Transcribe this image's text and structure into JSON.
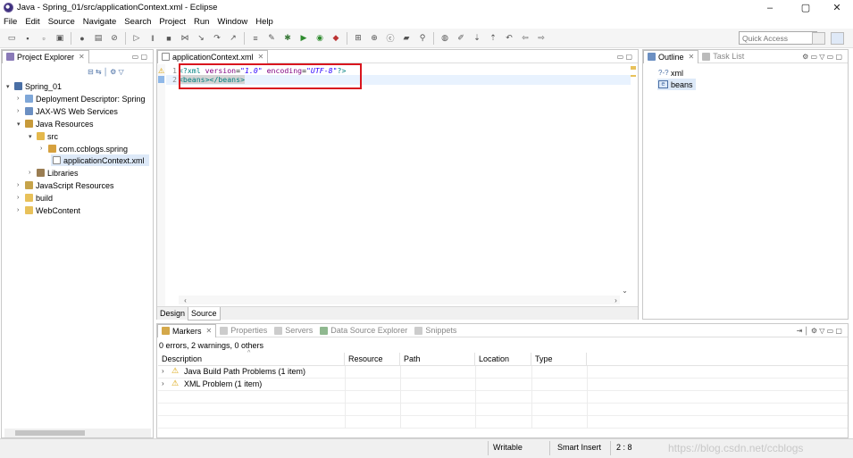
{
  "window": {
    "title": "Java - Spring_01/src/applicationContext.xml - Eclipse",
    "minimize": "–",
    "maximize": "▢",
    "close": "✕"
  },
  "menu": [
    "File",
    "Edit",
    "Source",
    "Navigate",
    "Search",
    "Project",
    "Run",
    "Window",
    "Help"
  ],
  "toolbar": {
    "quick_access_placeholder": "Quick Access"
  },
  "project_explorer": {
    "tab_label": "Project Explorer",
    "tree": [
      {
        "label": "Spring_01",
        "icon": "project-icon"
      },
      {
        "label": "Deployment Descriptor: Spring",
        "icon": "descriptor-icon"
      },
      {
        "label": "JAX-WS Web Services",
        "icon": "webservice-icon"
      },
      {
        "label": "Java Resources",
        "icon": "java-resources-icon"
      },
      {
        "label": "src",
        "icon": "source-folder-icon"
      },
      {
        "label": "com.ccblogs.spring",
        "icon": "package-icon"
      },
      {
        "label": "applicationContext.xml",
        "icon": "xml-file-icon"
      },
      {
        "label": "Libraries",
        "icon": "library-icon"
      },
      {
        "label": "JavaScript Resources",
        "icon": "js-resources-icon"
      },
      {
        "label": "build",
        "icon": "folder-icon"
      },
      {
        "label": "WebContent",
        "icon": "folder-icon"
      }
    ]
  },
  "editor": {
    "tab_label": "applicationContext.xml",
    "line_numbers": [
      "1",
      "2"
    ],
    "line1": {
      "p1": "<?xml ",
      "attr1": "version",
      "eq1": "=",
      "val1": "\"1.0\"",
      "attr2": " encoding",
      "eq2": "=",
      "val2": "\"UTF-8\"",
      "end": "?>"
    },
    "line2": {
      "open": "<beans>",
      "close": "</beans>"
    },
    "bottom_tabs": [
      "Design",
      "Source"
    ],
    "highlight_color": "#d9151e"
  },
  "outline": {
    "tab_label": "Outline",
    "task_list_label": "Task List",
    "items": [
      {
        "label": "xml",
        "icon": "?-?"
      },
      {
        "label": "beans",
        "icon": "e"
      }
    ]
  },
  "markers": {
    "tabs": [
      "Markers",
      "Properties",
      "Servers",
      "Data Source Explorer",
      "Snippets"
    ],
    "summary": "0 errors, 2 warnings, 0 others",
    "columns": [
      "Description",
      "Resource",
      "Path",
      "Location",
      "Type"
    ],
    "rows": [
      {
        "label": "Java Build Path Problems (1 item)"
      },
      {
        "label": "XML Problem (1 item)"
      }
    ]
  },
  "status_bar": {
    "mode": "Writable",
    "insert": "Smart Insert",
    "position": "2 : 8"
  },
  "watermark": "https://blog.csdn.net/ccblogs",
  "colors": {
    "accent": "#d9151e",
    "xml_tag": "#008080",
    "xml_attr": "#7f007f",
    "xml_value": "#2a00ff",
    "selection": "#dde9f8"
  }
}
